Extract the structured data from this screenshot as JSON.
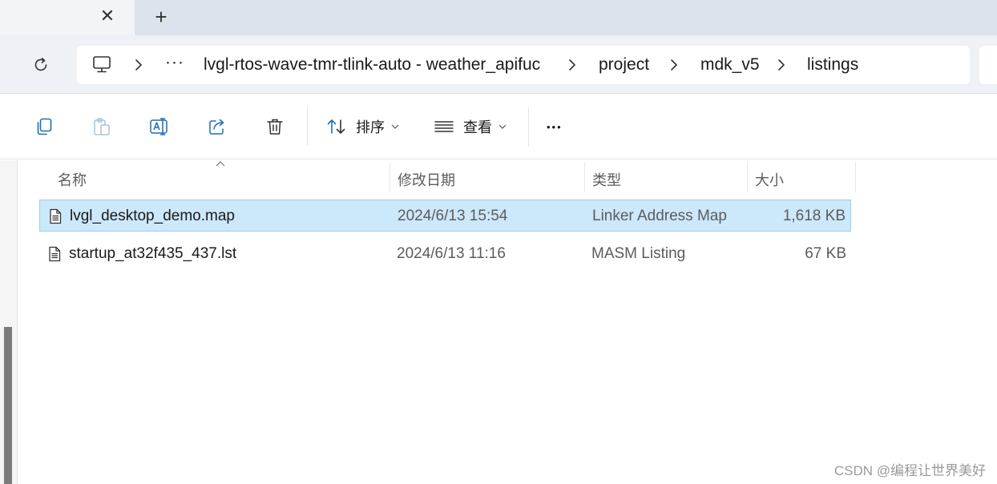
{
  "tab": {
    "close_glyph": "✕",
    "new_glyph": "+"
  },
  "breadcrumb": {
    "overflow": "···",
    "items": [
      {
        "label": "lvgl-rtos-wave-tmr-tlink-auto - weather_apifuc"
      },
      {
        "label": "project"
      },
      {
        "label": "mdk_v5"
      },
      {
        "label": "listings"
      }
    ]
  },
  "toolbar": {
    "sort_label": "排序",
    "view_label": "查看",
    "more_glyph": "•••"
  },
  "columns": {
    "name": "名称",
    "date": "修改日期",
    "type": "类型",
    "size": "大小"
  },
  "files": [
    {
      "name": "lvgl_desktop_demo.map",
      "date": "2024/6/13 15:54",
      "type": "Linker Address Map",
      "size": "1,618 KB",
      "selected": true
    },
    {
      "name": "startup_at32f435_437.lst",
      "date": "2024/6/13 11:16",
      "type": "MASM Listing",
      "size": "67 KB",
      "selected": false
    }
  ],
  "watermark": "CSDN @编程让世界美好",
  "colors": {
    "selection": "#cce8fb",
    "selection_border": "#99cff3",
    "icon_blue": "#1c6fb8"
  }
}
